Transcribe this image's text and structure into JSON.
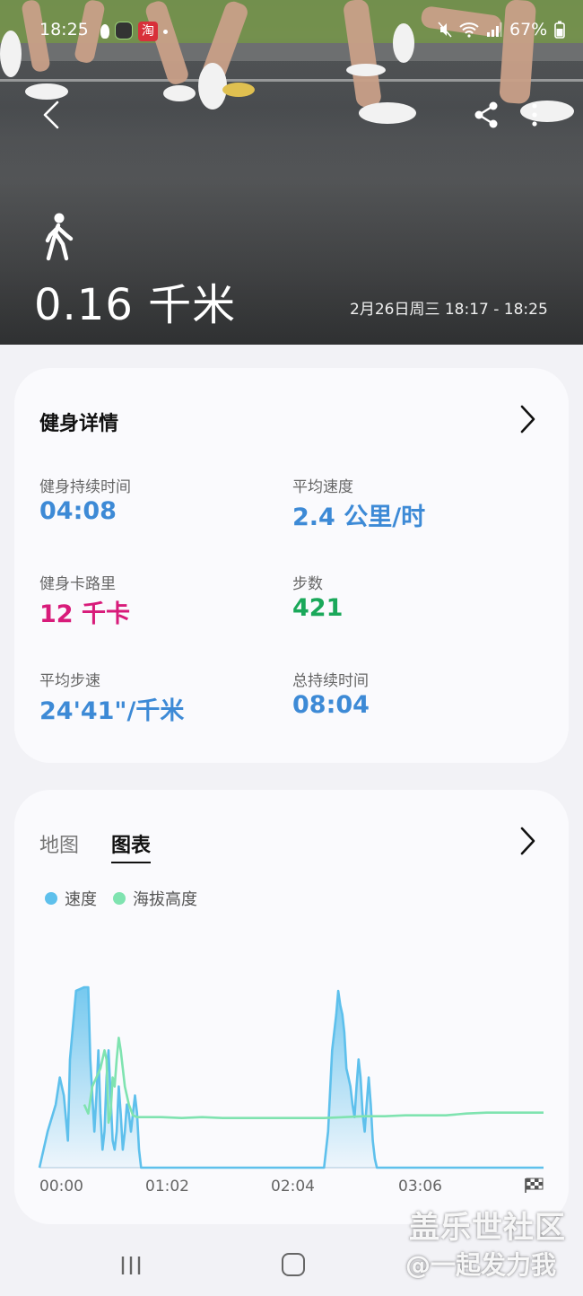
{
  "status_bar": {
    "time": "18:25",
    "battery": "67%",
    "app_badge": "淘"
  },
  "header": {
    "activity_icon": "walking-person-icon",
    "distance": "0.16 千米",
    "datetime": "2月26日周三 18:17 - 18:25"
  },
  "details": {
    "title": "健身详情",
    "metrics": [
      {
        "label": "健身持续时间",
        "value": "04:08",
        "color": "#3d8ad6"
      },
      {
        "label": "平均速度",
        "value": "2.4 公里/时",
        "color": "#3d8ad6"
      },
      {
        "label": "健身卡路里",
        "value": "12 千卡",
        "color": "#d81b7a"
      },
      {
        "label": "步数",
        "value": "421",
        "color": "#1aa85a"
      },
      {
        "label": "平均步速",
        "value": "24'41\"/千米",
        "color": "#3d8ad6"
      },
      {
        "label": "总持续时间",
        "value": "08:04",
        "color": "#3d8ad6"
      }
    ]
  },
  "chart_panel": {
    "tabs": [
      "地图",
      "图表"
    ],
    "active_tab": "图表",
    "legend": [
      {
        "name": "速度",
        "color": "#5ec0ec"
      },
      {
        "name": "海拔高度",
        "color": "#7fe3b0"
      }
    ],
    "x_ticks": [
      "00:00",
      "01:02",
      "02:04",
      "03:06"
    ]
  },
  "chart_data": {
    "type": "area",
    "x_unit": "elapsed time (s)",
    "xlim": [
      0,
      248
    ],
    "x_ticks": [
      "00:00",
      "01:02",
      "02:04",
      "03:06"
    ],
    "series": [
      {
        "name": "速度",
        "color": "#5ec0ec",
        "x": [
          0,
          4,
          8,
          10,
          12,
          14,
          15,
          18,
          22,
          24,
          25,
          27,
          28,
          29,
          30,
          31,
          32,
          33,
          34,
          35,
          36,
          37,
          38,
          39,
          40,
          41,
          42,
          43,
          44,
          45,
          46,
          47,
          48,
          49,
          50,
          52,
          60,
          80,
          100,
          130,
          140,
          142,
          144,
          145,
          146,
          147,
          148,
          149,
          150,
          151,
          152,
          153,
          154,
          155,
          156,
          157,
          158,
          159,
          160,
          161,
          162,
          163,
          164,
          165,
          166,
          168,
          180,
          200,
          248
        ],
        "values": [
          0,
          0.2,
          0.35,
          0.5,
          0.4,
          0.15,
          0.6,
          0.98,
          1.0,
          1.0,
          0.6,
          0.2,
          0.4,
          0.65,
          0.3,
          0.1,
          0.2,
          0.5,
          0.65,
          0.4,
          0.15,
          0.1,
          0.2,
          0.45,
          0.3,
          0.1,
          0.2,
          0.35,
          0.3,
          0.2,
          0.3,
          0.4,
          0.3,
          0.1,
          0,
          0,
          0,
          0,
          0,
          0,
          0,
          0.2,
          0.65,
          0.75,
          0.85,
          0.98,
          0.9,
          0.85,
          0.75,
          0.55,
          0.5,
          0.45,
          0.35,
          0.28,
          0.45,
          0.6,
          0.5,
          0.3,
          0.2,
          0.35,
          0.5,
          0.35,
          0.15,
          0.05,
          0,
          0,
          0,
          0,
          0
        ]
      },
      {
        "name": "海拔高度",
        "color": "#7fe3b0",
        "x": [
          22,
          24,
          26,
          28,
          30,
          32,
          33,
          34,
          35,
          36,
          37,
          38,
          39,
          40,
          41,
          42,
          44,
          46,
          48,
          50,
          60,
          70,
          80,
          90,
          100,
          110,
          120,
          130,
          140,
          150,
          160,
          170,
          180,
          190,
          200,
          210,
          220,
          230,
          240,
          248
        ],
        "values": [
          0.35,
          0.3,
          0.45,
          0.5,
          0.55,
          0.65,
          0.6,
          0.25,
          0.3,
          0.5,
          0.45,
          0.6,
          0.72,
          0.65,
          0.55,
          0.45,
          0.35,
          0.29,
          0.28,
          0.28,
          0.28,
          0.275,
          0.28,
          0.275,
          0.275,
          0.275,
          0.275,
          0.275,
          0.275,
          0.28,
          0.285,
          0.285,
          0.29,
          0.29,
          0.29,
          0.3,
          0.305,
          0.305,
          0.305,
          0.305
        ]
      }
    ],
    "ylim": [
      0,
      1
    ],
    "grid": false,
    "legend_position": "top-left"
  },
  "watermark": {
    "line1": "盖乐世社区",
    "line2": "@一起发力我"
  }
}
